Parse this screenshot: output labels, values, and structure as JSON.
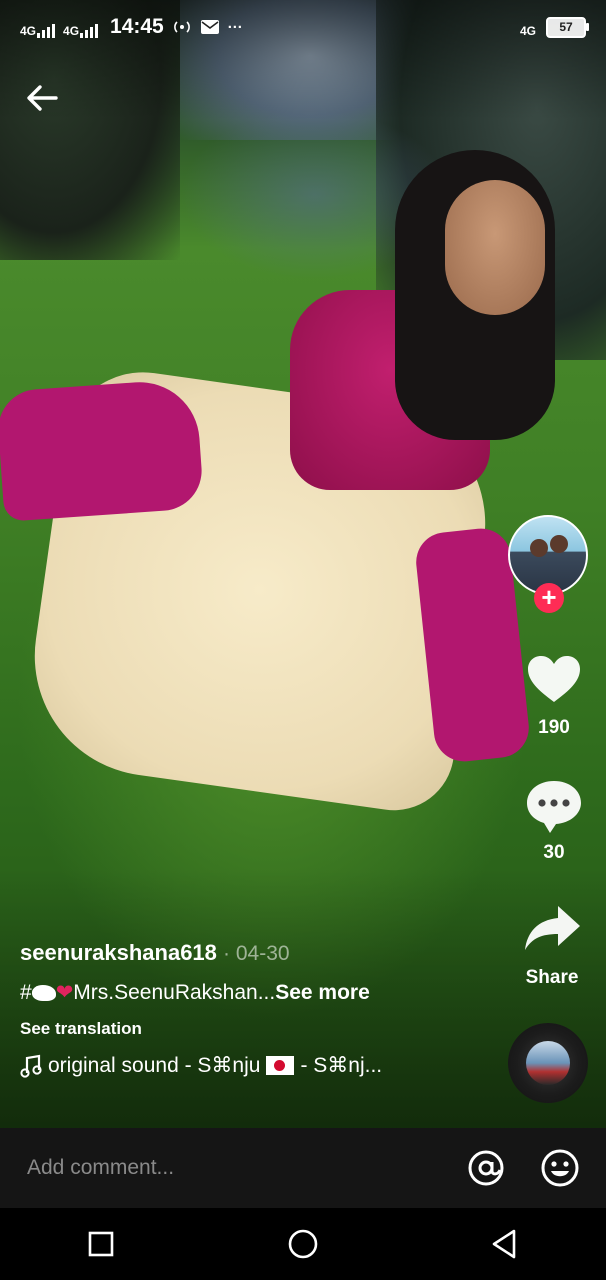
{
  "status_bar": {
    "net1": "4G",
    "net2": "4G",
    "time": "14:45",
    "net3": "4G",
    "battery": "57",
    "more": "···"
  },
  "post": {
    "username": "seenurakshana618",
    "date": "· 04-30",
    "caption_prefix": "#",
    "caption_text": "Mrs.SeenuRakshan...",
    "see_more": "See more",
    "see_translation": "See translation",
    "sound_label": "original sound - S⌘nju",
    "sound_tail": "- S⌘nj..."
  },
  "actions": {
    "likes": "190",
    "comments": "30",
    "share_label": "Share",
    "follow_plus": "+"
  },
  "comment_bar": {
    "placeholder": "Add comment..."
  },
  "icons": {
    "back": "arrow-left-icon",
    "heart": "heart-icon",
    "comment": "comment-bubble-icon",
    "share": "share-arrow-icon",
    "music": "music-note-icon",
    "mention": "at-sign-icon",
    "emoji": "emoji-icon",
    "nav_recents": "square-icon",
    "nav_home": "circle-icon",
    "nav_back": "triangle-back-icon"
  },
  "colors": {
    "follow_accent": "#fe2c55",
    "comment_bar_bg": "#151515"
  }
}
